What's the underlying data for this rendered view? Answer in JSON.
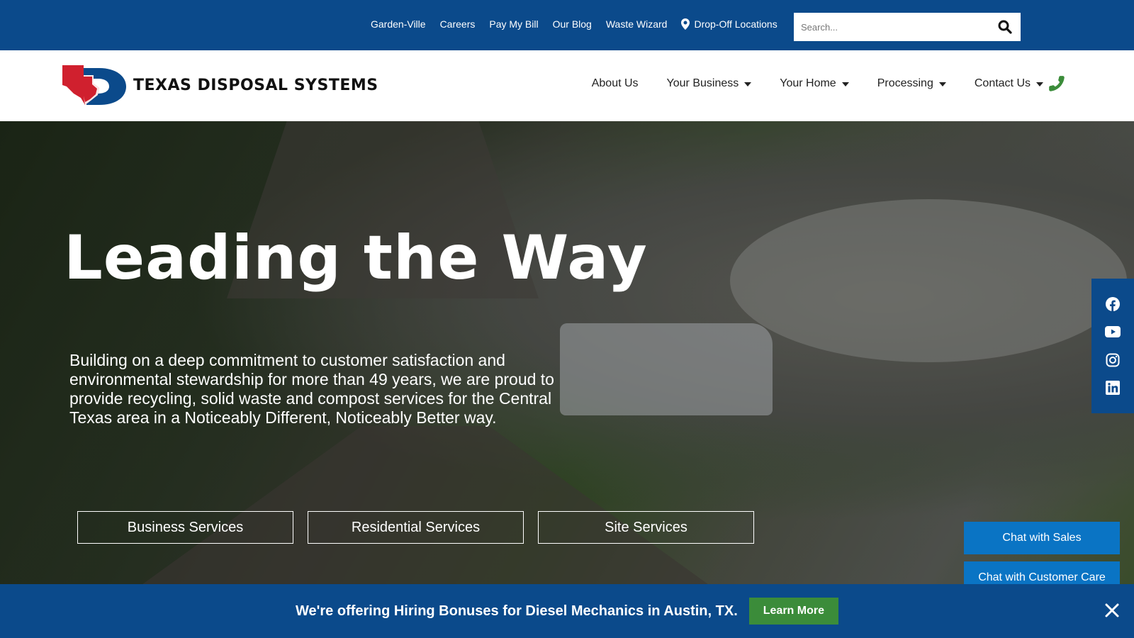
{
  "topbar": {
    "links": [
      "Garden-Ville",
      "Careers",
      "Pay My Bill",
      "Our Blog",
      "Waste Wizard"
    ],
    "dropoff_label": "Drop-Off Locations",
    "search_placeholder": "Search..."
  },
  "header": {
    "logo_text": "TEXAS DISPOSAL SYSTEMS",
    "nav": [
      {
        "label": "About Us",
        "dropdown": false
      },
      {
        "label": "Your Business",
        "dropdown": true
      },
      {
        "label": "Your Home",
        "dropdown": true
      },
      {
        "label": "Processing",
        "dropdown": true
      },
      {
        "label": "Contact Us",
        "dropdown": true
      }
    ]
  },
  "hero": {
    "title": "Leading the Way",
    "description": "Building on a deep commitment to customer satisfaction and environmental stewardship for more than 49 years, we are proud to provide recycling, solid waste and compost services for the Central Texas area in a Noticeably Different, Noticeably Better way.",
    "buttons": [
      "Business Services",
      "Residential Services",
      "Site Services"
    ]
  },
  "social": [
    "facebook-icon",
    "youtube-icon",
    "instagram-icon",
    "linkedin-icon"
  ],
  "chat": {
    "sales_label": "Chat with Sales",
    "care_label": "Chat with Customer Care"
  },
  "banner": {
    "text": "We're offering Hiring Bonuses for Diesel Mechanics in Austin, TX.",
    "button_label": "Learn More"
  },
  "colors": {
    "brand_blue": "#0b4a8b",
    "chat_blue": "#0a74c4",
    "accent_green": "#3b8c3a",
    "logo_red": "#d0202e"
  }
}
